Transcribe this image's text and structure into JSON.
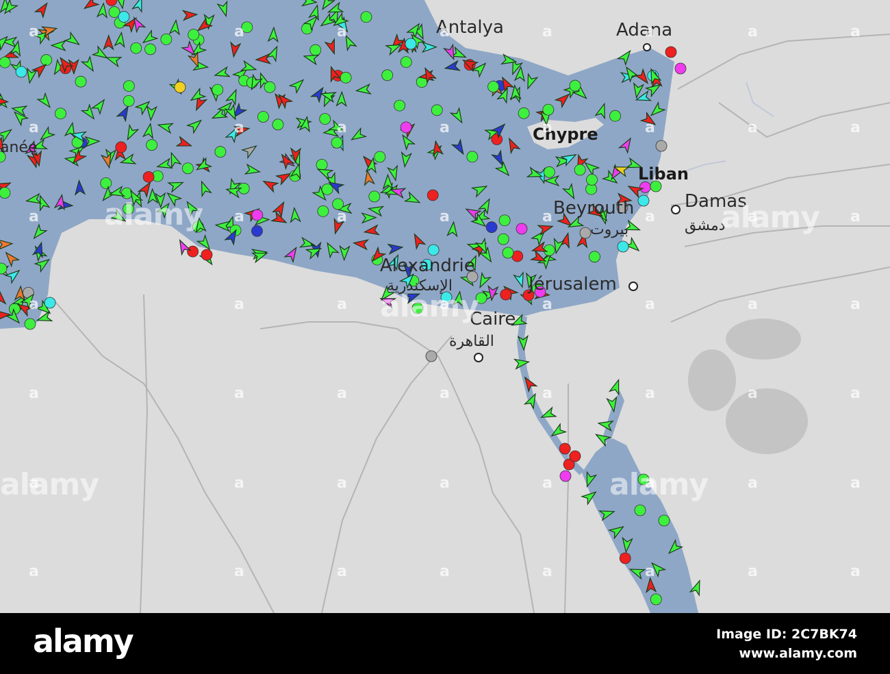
{
  "map": {
    "colors": {
      "land": "#dcdcdc",
      "sea": "#8fa7c6",
      "border": "#b4b4b4",
      "ship_green": "#3ef03e",
      "ship_red": "#ee2020",
      "ship_orange": "#f07830",
      "ship_magenta": "#ee3cee",
      "ship_cyan": "#3ce8e8",
      "ship_blue": "#2a3ad0",
      "ship_yellow": "#f0d020",
      "ship_grey": "#aaaaaa"
    },
    "labels": {
      "antalya": "Antalya",
      "adana": "Adana",
      "chypre": "Chypre",
      "liban": "Liban",
      "beyrouth": "Beyrouth",
      "beyrouth_ar": "بيروت",
      "damas": "Damas",
      "damas_ar": "دمشق",
      "alexandrie": "Alexandrie",
      "alexandrie_ar": "الإسكندرية",
      "jerusalem": "Jérusalem",
      "caire": "Caire",
      "caire_ar": "القاهرة",
      "mediterranee_fragment": "anée"
    }
  },
  "watermark": {
    "text": "alamy",
    "number": "a"
  },
  "footer": {
    "logo": "alamy",
    "image_id": "Image ID: 2C7BK74",
    "url": "www.alamy.com"
  }
}
